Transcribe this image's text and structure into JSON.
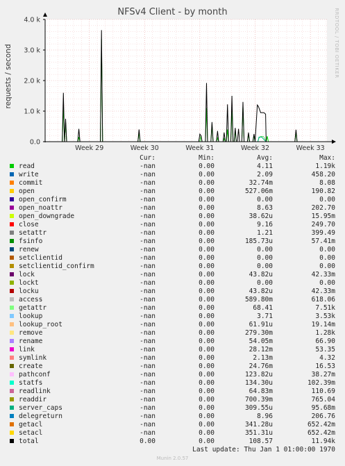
{
  "chart_data": {
    "type": "line",
    "title": "NFSv4 Client - by month",
    "ylabel": "requests / second",
    "ylim": [
      0,
      4000
    ],
    "yticks": [
      "0.0",
      "1.0 k",
      "2.0 k",
      "3.0 k",
      "4.0 k"
    ],
    "ytick_values": [
      0,
      1000,
      2000,
      3000,
      4000
    ],
    "xticks": [
      "Week 29",
      "Week 30",
      "Week 31",
      "Week 32",
      "Week 33"
    ],
    "xtick_values": [
      29,
      30,
      31,
      32,
      33
    ],
    "xlim": [
      28.2,
      33.3
    ],
    "grid": true,
    "series": [
      {
        "name": "read",
        "color": "#00cc00",
        "points": [
          [
            28.51,
            0
          ],
          [
            28.53,
            1190
          ],
          [
            28.55,
            0
          ],
          [
            28.57,
            650
          ],
          [
            28.59,
            0
          ],
          [
            28.79,
            0
          ],
          [
            28.81,
            150
          ],
          [
            28.83,
            0
          ],
          [
            29.2,
            0
          ],
          [
            29.22,
            3350
          ],
          [
            29.24,
            0
          ],
          [
            29.88,
            0
          ],
          [
            29.9,
            300
          ],
          [
            29.92,
            0
          ],
          [
            31.0,
            0
          ],
          [
            31.02,
            200
          ],
          [
            31.04,
            0
          ],
          [
            31.1,
            0
          ],
          [
            31.12,
            1100
          ],
          [
            31.14,
            0
          ],
          [
            31.2,
            0
          ],
          [
            31.22,
            550
          ],
          [
            31.24,
            0
          ],
          [
            31.3,
            0
          ],
          [
            31.32,
            120
          ],
          [
            31.34,
            0
          ],
          [
            31.42,
            0
          ],
          [
            31.44,
            100
          ],
          [
            31.46,
            0
          ],
          [
            31.48,
            0
          ],
          [
            31.5,
            400
          ],
          [
            31.52,
            0
          ],
          [
            31.56,
            0
          ],
          [
            31.58,
            1090
          ],
          [
            31.6,
            0
          ],
          [
            31.62,
            0
          ],
          [
            31.64,
            350
          ],
          [
            31.66,
            0
          ],
          [
            31.76,
            0
          ],
          [
            31.78,
            1150
          ],
          [
            31.8,
            0
          ],
          [
            31.86,
            0
          ],
          [
            31.88,
            250
          ],
          [
            31.9,
            0
          ],
          [
            31.96,
            0
          ],
          [
            31.98,
            200
          ],
          [
            32.0,
            0
          ],
          [
            32.2,
            0
          ],
          [
            32.22,
            180
          ],
          [
            32.24,
            0
          ],
          [
            32.72,
            0
          ],
          [
            32.74,
            300
          ],
          [
            32.76,
            0
          ]
        ]
      },
      {
        "name": "getattr",
        "color": "#66dd66",
        "points": [
          [
            32.05,
            0
          ],
          [
            32.07,
            120
          ],
          [
            32.1,
            170
          ],
          [
            32.15,
            170
          ],
          [
            32.18,
            80
          ],
          [
            32.2,
            0
          ]
        ]
      },
      {
        "name": "server_caps",
        "color": "#00b080",
        "points": [
          [
            32.05,
            0
          ],
          [
            32.07,
            150
          ],
          [
            32.12,
            150
          ],
          [
            32.17,
            50
          ],
          [
            32.2,
            0
          ]
        ]
      },
      {
        "name": "total",
        "color": "#000000",
        "points": [
          [
            28.2,
            0
          ],
          [
            28.51,
            0
          ],
          [
            28.53,
            1600
          ],
          [
            28.55,
            0
          ],
          [
            28.57,
            750
          ],
          [
            28.59,
            0
          ],
          [
            28.79,
            0
          ],
          [
            28.81,
            420
          ],
          [
            28.83,
            0
          ],
          [
            29.2,
            0
          ],
          [
            29.22,
            3650
          ],
          [
            29.24,
            0
          ],
          [
            29.88,
            0
          ],
          [
            29.9,
            400
          ],
          [
            29.92,
            0
          ],
          [
            30.2,
            0
          ],
          [
            30.8,
            0
          ],
          [
            30.98,
            0
          ],
          [
            31.0,
            250
          ],
          [
            31.02,
            200
          ],
          [
            31.04,
            0
          ],
          [
            31.1,
            0
          ],
          [
            31.12,
            1920
          ],
          [
            31.14,
            0
          ],
          [
            31.2,
            0
          ],
          [
            31.22,
            640
          ],
          [
            31.24,
            0
          ],
          [
            31.3,
            0
          ],
          [
            31.32,
            350
          ],
          [
            31.34,
            0
          ],
          [
            31.42,
            0
          ],
          [
            31.44,
            300
          ],
          [
            31.46,
            0
          ],
          [
            31.48,
            0
          ],
          [
            31.5,
            1220
          ],
          [
            31.52,
            0
          ],
          [
            31.56,
            0
          ],
          [
            31.58,
            1500
          ],
          [
            31.6,
            0
          ],
          [
            31.62,
            0
          ],
          [
            31.64,
            450
          ],
          [
            31.66,
            0
          ],
          [
            31.68,
            0
          ],
          [
            31.7,
            420
          ],
          [
            31.72,
            0
          ],
          [
            31.76,
            0
          ],
          [
            31.78,
            1300
          ],
          [
            31.8,
            0
          ],
          [
            31.86,
            0
          ],
          [
            31.88,
            300
          ],
          [
            31.9,
            0
          ],
          [
            31.96,
            0
          ],
          [
            31.98,
            250
          ],
          [
            32.0,
            0
          ],
          [
            32.04,
            1200
          ],
          [
            32.06,
            1150
          ],
          [
            32.1,
            950
          ],
          [
            32.16,
            950
          ],
          [
            32.19,
            900
          ],
          [
            32.2,
            0
          ],
          [
            32.3,
            0
          ],
          [
            32.72,
            0
          ],
          [
            32.74,
            390
          ],
          [
            32.76,
            0
          ],
          [
            33.3,
            0
          ]
        ]
      }
    ]
  },
  "legend": {
    "headers": {
      "cur": "Cur:",
      "min": "Min:",
      "avg": "Avg:",
      "max": "Max:"
    },
    "rows": [
      {
        "name": "read",
        "color": "#00cc00",
        "cur": "-nan",
        "min": "0.00",
        "avg": "4.11",
        "max": "1.19k"
      },
      {
        "name": "write",
        "color": "#0066b3",
        "cur": "-nan",
        "min": "0.00",
        "avg": "2.09",
        "max": "458.20"
      },
      {
        "name": "commit",
        "color": "#ff8000",
        "cur": "-nan",
        "min": "0.00",
        "avg": "32.74m",
        "max": "8.08"
      },
      {
        "name": "open",
        "color": "#ffcc00",
        "cur": "-nan",
        "min": "0.00",
        "avg": "527.06m",
        "max": "190.82"
      },
      {
        "name": "open_confirm",
        "color": "#330099",
        "cur": "-nan",
        "min": "0.00",
        "avg": "0.00",
        "max": "0.00"
      },
      {
        "name": "open_noattr",
        "color": "#990099",
        "cur": "-nan",
        "min": "0.00",
        "avg": "8.63",
        "max": "202.70"
      },
      {
        "name": "open_downgrade",
        "color": "#ccff00",
        "cur": "-nan",
        "min": "0.00",
        "avg": "38.62u",
        "max": "15.95m"
      },
      {
        "name": "close",
        "color": "#ff0000",
        "cur": "-nan",
        "min": "0.00",
        "avg": "9.16",
        "max": "249.70"
      },
      {
        "name": "setattr",
        "color": "#808080",
        "cur": "-nan",
        "min": "0.00",
        "avg": "1.21",
        "max": "399.49"
      },
      {
        "name": "fsinfo",
        "color": "#008f00",
        "cur": "-nan",
        "min": "0.00",
        "avg": "185.73u",
        "max": "57.41m"
      },
      {
        "name": "renew",
        "color": "#00487d",
        "cur": "-nan",
        "min": "0.00",
        "avg": "0.00",
        "max": "0.00"
      },
      {
        "name": "setclientid",
        "color": "#b35a00",
        "cur": "-nan",
        "min": "0.00",
        "avg": "0.00",
        "max": "0.00"
      },
      {
        "name": "setclientid_confirm",
        "color": "#b38f00",
        "cur": "-nan",
        "min": "0.00",
        "avg": "0.00",
        "max": "0.00"
      },
      {
        "name": "lock",
        "color": "#6b006b",
        "cur": "-nan",
        "min": "0.00",
        "avg": "43.82u",
        "max": "42.33m"
      },
      {
        "name": "lockt",
        "color": "#8fb300",
        "cur": "-nan",
        "min": "0.00",
        "avg": "0.00",
        "max": "0.00"
      },
      {
        "name": "locku",
        "color": "#b30000",
        "cur": "-nan",
        "min": "0.00",
        "avg": "43.82u",
        "max": "42.33m"
      },
      {
        "name": "access",
        "color": "#bebebe",
        "cur": "-nan",
        "min": "0.00",
        "avg": "589.80m",
        "max": "618.06"
      },
      {
        "name": "getattr",
        "color": "#80ff80",
        "cur": "-nan",
        "min": "0.00",
        "avg": "68.41",
        "max": "7.51k"
      },
      {
        "name": "lookup",
        "color": "#80c9ff",
        "cur": "-nan",
        "min": "0.00",
        "avg": "3.71",
        "max": "3.53k"
      },
      {
        "name": "lookup_root",
        "color": "#ffc080",
        "cur": "-nan",
        "min": "0.00",
        "avg": "61.91u",
        "max": "19.14m"
      },
      {
        "name": "remove",
        "color": "#ffe680",
        "cur": "-nan",
        "min": "0.00",
        "avg": "279.30m",
        "max": "1.28k"
      },
      {
        "name": "rename",
        "color": "#aa80ff",
        "cur": "-nan",
        "min": "0.00",
        "avg": "54.05m",
        "max": "66.90"
      },
      {
        "name": "link",
        "color": "#ee00cc",
        "cur": "-nan",
        "min": "0.00",
        "avg": "28.12m",
        "max": "53.35"
      },
      {
        "name": "symlink",
        "color": "#ff8080",
        "cur": "-nan",
        "min": "0.00",
        "avg": "2.13m",
        "max": "4.32"
      },
      {
        "name": "create",
        "color": "#666600",
        "cur": "-nan",
        "min": "0.00",
        "avg": "24.76m",
        "max": "16.53"
      },
      {
        "name": "pathconf",
        "color": "#ffbfff",
        "cur": "-nan",
        "min": "0.00",
        "avg": "123.82u",
        "max": "38.27m"
      },
      {
        "name": "statfs",
        "color": "#00ffcc",
        "cur": "-nan",
        "min": "0.00",
        "avg": "134.30u",
        "max": "102.39m"
      },
      {
        "name": "readlink",
        "color": "#cc6699",
        "cur": "-nan",
        "min": "0.00",
        "avg": "64.83m",
        "max": "110.69"
      },
      {
        "name": "readdir",
        "color": "#999900",
        "cur": "-nan",
        "min": "0.00",
        "avg": "700.39m",
        "max": "765.04"
      },
      {
        "name": "server_caps",
        "color": "#00b080",
        "cur": "-nan",
        "min": "0.00",
        "avg": "309.55u",
        "max": "95.68m"
      },
      {
        "name": "delegreturn",
        "color": "#0080c0",
        "cur": "-nan",
        "min": "0.00",
        "avg": "8.96",
        "max": "206.76"
      },
      {
        "name": "getacl",
        "color": "#e07000",
        "cur": "-nan",
        "min": "0.00",
        "avg": "341.28u",
        "max": "652.42m"
      },
      {
        "name": "setacl",
        "color": "#ffd700",
        "cur": "-nan",
        "min": "0.00",
        "avg": "351.31u",
        "max": "652.42m"
      },
      {
        "name": "total",
        "color": "#000000",
        "cur": "0.00",
        "min": "0.00",
        "avg": "108.57",
        "max": "11.94k"
      }
    ]
  },
  "last_update": "Last update: Thu Jan  1 01:00:00 1970",
  "watermark": "RRDTOOL / TOBI OETIKER",
  "footer": "Munin 2.0.57"
}
